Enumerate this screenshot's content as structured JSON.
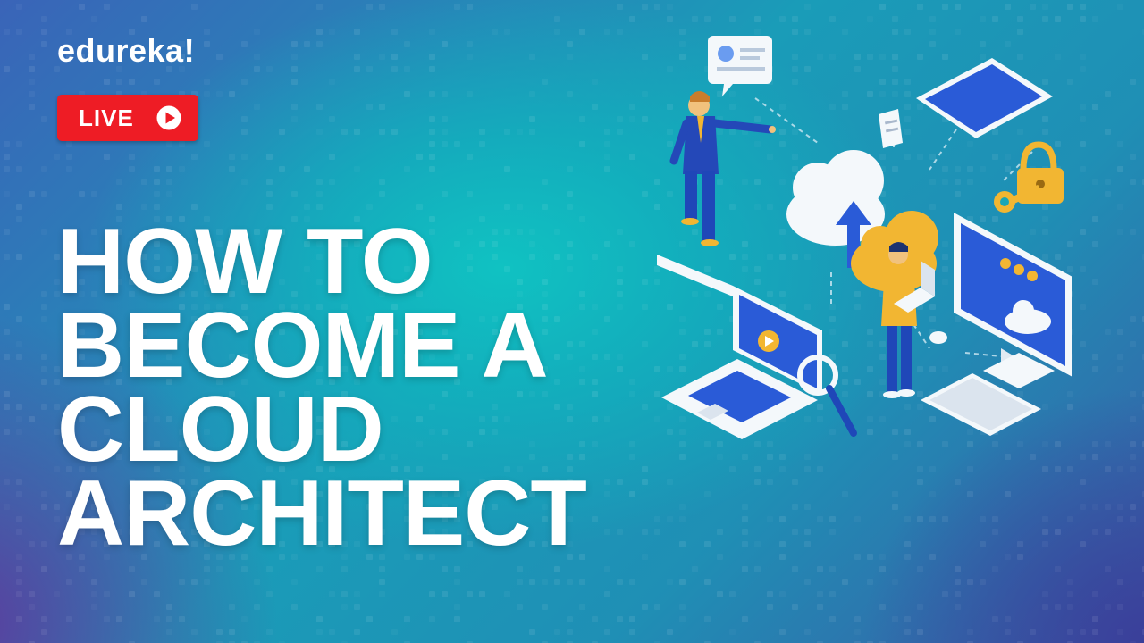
{
  "brand": {
    "logo_text": "edureka!"
  },
  "badge": {
    "label": "LIVE",
    "icon": "play-circle-icon"
  },
  "headline": {
    "lines": [
      "HOW TO",
      "BECOME A",
      "CLOUD",
      "ARCHITECT"
    ]
  },
  "illustration": {
    "icons": [
      "speech-bubble-icon",
      "tablet-icon",
      "document-icon",
      "padlock-icon",
      "key-icon",
      "cloud-upload-icon",
      "gold-cloud-icon",
      "desktop-monitor-icon",
      "keyboard-icon",
      "mouse-icon",
      "laptop-icon",
      "magnifier-icon",
      "browser-window-icon",
      "person-pointing-icon",
      "person-with-laptop-icon"
    ]
  },
  "colors": {
    "badge_red": "#ee1c25",
    "text_white": "#ffffff",
    "teal_glow": "#10c2c2",
    "purple_corner": "#5b3d9e",
    "gold_accent": "#f2b632",
    "blue_accent": "#2a5bd7"
  }
}
